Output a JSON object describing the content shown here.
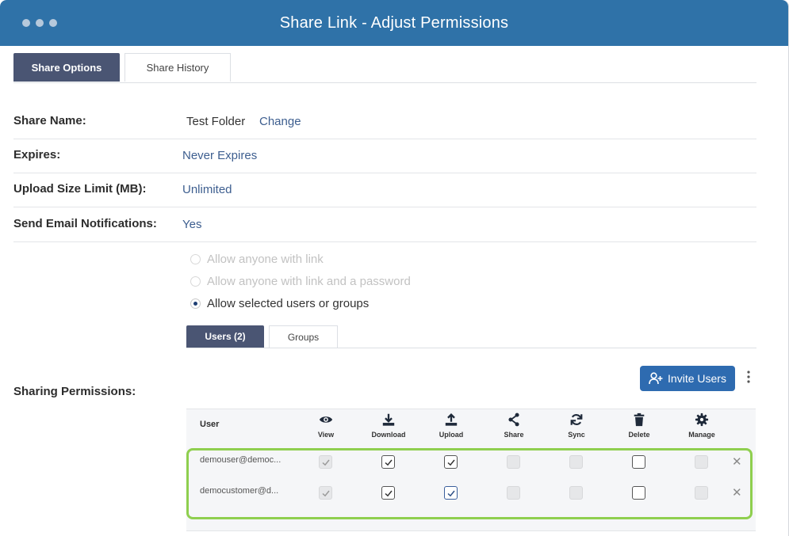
{
  "window": {
    "title": "Share Link - Adjust Permissions"
  },
  "tabs": [
    {
      "label": "Share Options",
      "active": true
    },
    {
      "label": "Share History",
      "active": false
    }
  ],
  "share_name": {
    "label": "Share Name:",
    "value": "Test Folder",
    "change_link": "Change"
  },
  "expires": {
    "label": "Expires:",
    "value": "Never Expires"
  },
  "upload_limit": {
    "label": "Upload Size Limit (MB):",
    "value": "Unlimited"
  },
  "email_notifications": {
    "label": "Send Email Notifications:",
    "value": "Yes"
  },
  "access_options": [
    {
      "label": "Allow anyone with link",
      "selected": false,
      "enabled": false
    },
    {
      "label": "Allow anyone with link and a password",
      "selected": false,
      "enabled": false
    },
    {
      "label": "Allow selected users or groups",
      "selected": true,
      "enabled": true
    }
  ],
  "sub_tabs": [
    {
      "label": "Users (2)",
      "active": true
    },
    {
      "label": "Groups",
      "active": false
    }
  ],
  "sharing_permissions": {
    "label": "Sharing Permissions:",
    "invite_button": "Invite Users",
    "columns": {
      "user": "User",
      "view": "View",
      "download": "Download",
      "upload": "Upload",
      "share": "Share",
      "sync": "Sync",
      "delete": "Delete",
      "manage": "Manage"
    },
    "rows": [
      {
        "email": "demouser@democ...",
        "view": "checked-disabled",
        "download": "checked",
        "upload": "checked",
        "share": "disabled",
        "sync": "disabled",
        "delete": "unchecked",
        "manage": "disabled"
      },
      {
        "email": "democustomer@d...",
        "view": "checked-disabled",
        "download": "checked",
        "upload": "checked",
        "share": "disabled",
        "sync": "disabled",
        "delete": "unchecked",
        "manage": "disabled"
      }
    ]
  },
  "colors": {
    "titlebar": "#2f72a8",
    "active_tab": "#4a5573",
    "link": "#3d5e8f",
    "button": "#2e6bb0",
    "highlight": "#8fcf4f"
  },
  "icons": {
    "view": "eye-icon",
    "download": "download-icon",
    "upload": "upload-icon",
    "share": "share-icon",
    "sync": "sync-icon",
    "delete": "trash-icon",
    "manage": "gear-icon",
    "invite": "add-user-icon",
    "more": "kebab-icon",
    "remove": "close-icon"
  }
}
